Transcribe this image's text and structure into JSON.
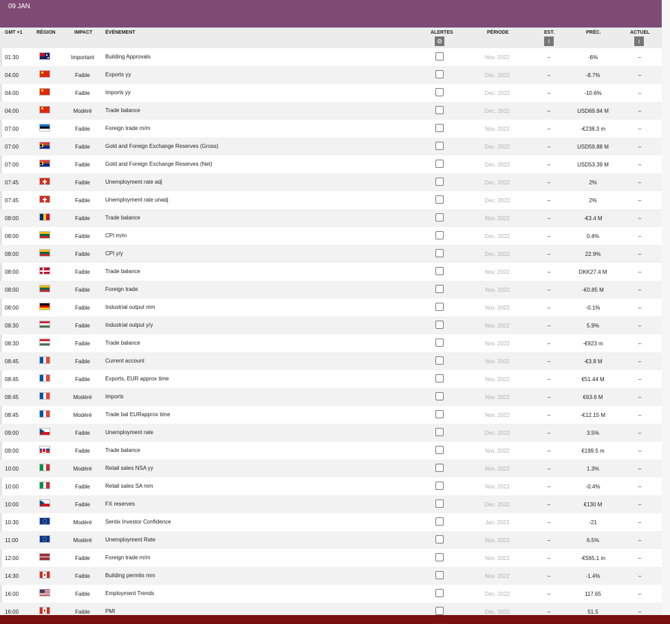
{
  "banner": {
    "date": "09 JAN"
  },
  "header": {
    "gmt": "GMT +1",
    "region": "RÉGION",
    "impact": "IMPACT",
    "event": "ÉVÉNEMENT",
    "alerts": "ALERTES",
    "period": "PÉRIODE",
    "est": "EST.",
    "prev": "PRÉC.",
    "actual": "ACTUEL",
    "alerts_icon": "gear-icon",
    "est_icon": "info-icon",
    "actual_icon": "info-icon"
  },
  "rows": [
    {
      "time": "01:30",
      "flag": "australia",
      "impact": "Important",
      "event": "Building Approvals",
      "period": "Nov. 2022",
      "est": "–",
      "prev": "-6%",
      "actual": "–"
    },
    {
      "time": "04:00",
      "flag": "china",
      "impact": "Faible",
      "event": "Exports yy",
      "period": "Dec. 2022",
      "est": "–",
      "prev": "-8.7%",
      "actual": "–"
    },
    {
      "time": "04:00",
      "flag": "china",
      "impact": "Faible",
      "event": "Imports yy",
      "period": "Dec. 2022",
      "est": "–",
      "prev": "-10.6%",
      "actual": "–"
    },
    {
      "time": "04:00",
      "flag": "china",
      "impact": "Modéré",
      "event": "Trade balance",
      "period": "Dec. 2022",
      "est": "–",
      "prev": "USD69.84 M",
      "actual": "–"
    },
    {
      "time": "07:00",
      "flag": "estonia",
      "impact": "Faible",
      "event": "Foreign trade m/m",
      "period": "Nov. 2022",
      "est": "–",
      "prev": "-€238.3 m",
      "actual": "–"
    },
    {
      "time": "07:00",
      "flag": "south-africa",
      "impact": "Faible",
      "event": "Gold and Foreign Exchange Reserves (Gross)",
      "period": "Dec. 2022",
      "est": "–",
      "prev": "USD59.88 M",
      "actual": "–"
    },
    {
      "time": "07:00",
      "flag": "south-africa",
      "impact": "Faible",
      "event": "Gold and Foreign Exchange Reserves (Net)",
      "period": "Dec. 2022",
      "est": "–",
      "prev": "USD53.39 M",
      "actual": "–"
    },
    {
      "time": "07:45",
      "flag": "switzerland",
      "impact": "Faible",
      "event": "Unemployment rate adj",
      "period": "Dec. 2022",
      "est": "–",
      "prev": "2%",
      "actual": "–"
    },
    {
      "time": "07:45",
      "flag": "switzerland",
      "impact": "Faible",
      "event": "Unemployment rate unadj",
      "period": "Dec. 2022",
      "est": "–",
      "prev": "2%",
      "actual": "–"
    },
    {
      "time": "08:00",
      "flag": "romania",
      "impact": "Faible",
      "event": "Trade balance",
      "period": "Nov. 2022",
      "est": "–",
      "prev": "-€3.4 M",
      "actual": "–"
    },
    {
      "time": "08:00",
      "flag": "lithuania",
      "impact": "Faible",
      "event": "CPI m/m",
      "period": "Dec. 2022",
      "est": "–",
      "prev": "0.4%",
      "actual": "–"
    },
    {
      "time": "08:00",
      "flag": "lithuania",
      "impact": "Faible",
      "event": "CPI y/y",
      "period": "Dec. 2022",
      "est": "–",
      "prev": "22.9%",
      "actual": "–"
    },
    {
      "time": "08:00",
      "flag": "denmark",
      "impact": "Faible",
      "event": "Trade balance",
      "period": "Nov. 2022",
      "est": "–",
      "prev": "DKK27.4 M",
      "actual": "–"
    },
    {
      "time": "08:00",
      "flag": "lithuania",
      "impact": "Faible",
      "event": "Foreign trade",
      "period": "Nov. 2022",
      "est": "–",
      "prev": "-€0.85 M",
      "actual": "–"
    },
    {
      "time": "08:00",
      "flag": "germany",
      "impact": "Faible",
      "event": "Industrial output mm",
      "period": "Nov. 2022",
      "est": "–",
      "prev": "-0.1%",
      "actual": "–"
    },
    {
      "time": "08:30",
      "flag": "hungary",
      "impact": "Faible",
      "event": "Industrial output y/y",
      "period": "Nov. 2022",
      "est": "–",
      "prev": "5.9%",
      "actual": "–"
    },
    {
      "time": "08:30",
      "flag": "hungary",
      "impact": "Faible",
      "event": "Trade balance",
      "period": "Nov. 2022",
      "est": "–",
      "prev": "-€923 m",
      "actual": "–"
    },
    {
      "time": "08:45",
      "flag": "france",
      "impact": "Faible",
      "event": "Current account",
      "period": "Nov. 2022",
      "est": "–",
      "prev": "-€3.8 M",
      "actual": "–"
    },
    {
      "time": "08:45",
      "flag": "france",
      "impact": "Faible",
      "event": "Exports, EUR approx time",
      "period": "Nov. 2022",
      "est": "–",
      "prev": "€51.44 M",
      "actual": "–"
    },
    {
      "time": "08:45",
      "flag": "france",
      "impact": "Modéré",
      "event": "Imports",
      "period": "Nov. 2022",
      "est": "–",
      "prev": "€63.6 M",
      "actual": "–"
    },
    {
      "time": "08:45",
      "flag": "france",
      "impact": "Modéré",
      "event": "Trade bal EURapprox time",
      "period": "Nov. 2022",
      "est": "–",
      "prev": "-€12.15 M",
      "actual": "–"
    },
    {
      "time": "09:00",
      "flag": "czech",
      "impact": "Faible",
      "event": "Unemployment rate",
      "period": "Dec. 2022",
      "est": "–",
      "prev": "3.5%",
      "actual": "–"
    },
    {
      "time": "09:00",
      "flag": "slovakia",
      "impact": "Faible",
      "event": "Trade balance",
      "period": "Nov. 2022",
      "est": "–",
      "prev": "€199.5 m",
      "actual": "–"
    },
    {
      "time": "10:00",
      "flag": "italy",
      "impact": "Modéré",
      "event": "Retail sales NSA yy",
      "period": "Nov. 2022",
      "est": "–",
      "prev": "1.3%",
      "actual": "–"
    },
    {
      "time": "10:00",
      "flag": "italy",
      "impact": "Faible",
      "event": "Retail sales SA mm",
      "period": "Nov. 2022",
      "est": "–",
      "prev": "-0.4%",
      "actual": "–"
    },
    {
      "time": "10:00",
      "flag": "czech",
      "impact": "Faible",
      "event": "FX reserves",
      "period": "Dec. 2022",
      "est": "–",
      "prev": "€130 M",
      "actual": "–"
    },
    {
      "time": "10:30",
      "flag": "eu",
      "impact": "Modéré",
      "event": "Sentix Investor Confidence",
      "period": "Jan. 2023",
      "est": "–",
      "prev": "-21",
      "actual": "–"
    },
    {
      "time": "11:00",
      "flag": "eu",
      "impact": "Modéré",
      "event": "Unemployment Rate",
      "period": "Nov. 2022",
      "est": "–",
      "prev": "6.5%",
      "actual": "–"
    },
    {
      "time": "12:00",
      "flag": "latvia",
      "impact": "Faible",
      "event": "Foreign trade m/m",
      "period": "Nov. 2022",
      "est": "–",
      "prev": "-€565.1 m",
      "actual": "–"
    },
    {
      "time": "14:30",
      "flag": "canada",
      "impact": "Faible",
      "event": "Building permits mm",
      "period": "Nov. 2022",
      "est": "–",
      "prev": "-1.4%",
      "actual": "–"
    },
    {
      "time": "16:00",
      "flag": "usa",
      "impact": "Faible",
      "event": "Employment Trends",
      "period": "Dec. 2022",
      "est": "–",
      "prev": "117.65",
      "actual": "–"
    },
    {
      "time": "16:00",
      "flag": "canada",
      "impact": "Faible",
      "event": "PMI",
      "period": "Dec. 2022",
      "est": "–",
      "prev": "51.5",
      "actual": "–"
    }
  ]
}
